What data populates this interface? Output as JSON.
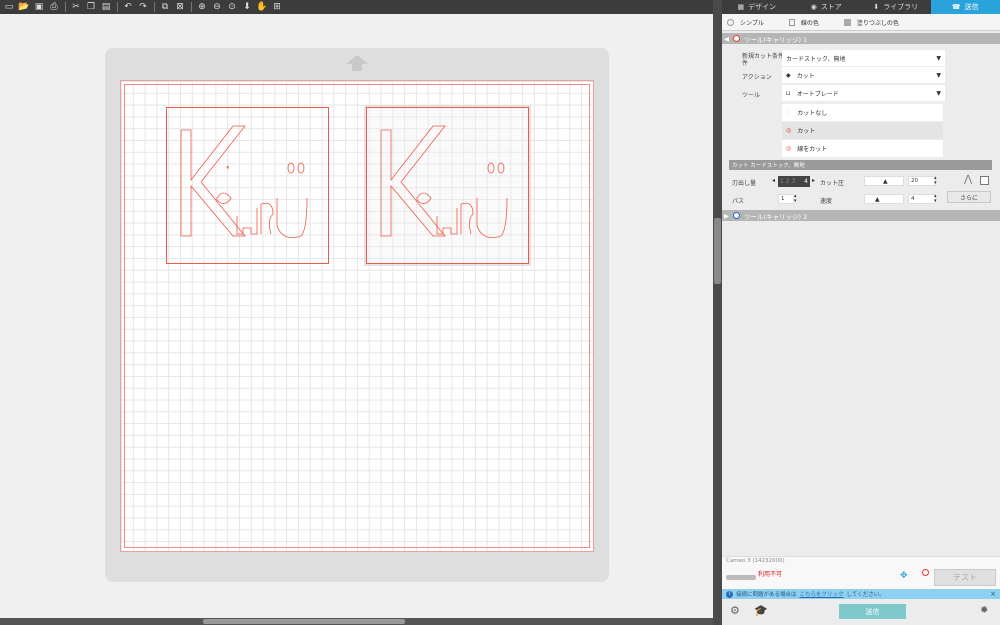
{
  "toolbar": {
    "icons": [
      "new-icon",
      "open-icon",
      "save-icon",
      "print-icon",
      "cut-icon",
      "copy-icon",
      "paste-icon",
      "undo-icon",
      "redo-icon",
      "group-icon",
      "ungroup-icon",
      "zoom-in-icon",
      "zoom-out-icon",
      "zoom-select-icon",
      "zoom-fit-icon",
      "pan-icon",
      "fit-mat-icon"
    ]
  },
  "design": {
    "letters_1": "K",
    "letters_2": "HRU",
    "umlaut": "ö"
  },
  "tabs": {
    "design": "デザイン",
    "store": "ストア",
    "library": "ライブラリ",
    "send": "送信"
  },
  "subtabs": {
    "simple": "シンプル",
    "line_color": "線の色",
    "fill_color": "塗りつぶしの色"
  },
  "carriage1": {
    "title": "ツール(キャリッジ) 1",
    "color": "#e63a2e"
  },
  "carriage2": {
    "title": "ツール(キャリッジ) 2",
    "color": "#2a5fd8"
  },
  "settings": {
    "material_label": "新規カット条件",
    "material_label2": "件",
    "material_value": "カードストック、無地",
    "action_label": "アクション",
    "action_value": "カット",
    "tool_label": "ツール",
    "tool_value": "オートブレード",
    "options": [
      "カットなし",
      "カット",
      "線をカット"
    ]
  },
  "material_header": "カット カードストック、無地",
  "params": {
    "blade_label": "刃出し量",
    "blade_value": "4",
    "blade_digits": "1 2 3",
    "force_label": "カット圧",
    "force_value": "20",
    "passes_label": "パス",
    "passes_value": "1",
    "speed_label": "速度",
    "speed_value": "4",
    "more_button": "さらに"
  },
  "device": {
    "name": "Cameo 3 (14232000)",
    "status": "利用不可",
    "test_button": "テスト"
  },
  "info_bar": {
    "text": "接続に問題がある場合は",
    "link": "こちらをクリック",
    "text2": "してください。"
  },
  "send_button": "送信",
  "colors": {
    "accent": "#29a3d9",
    "cut_line": "#f05a4a"
  }
}
